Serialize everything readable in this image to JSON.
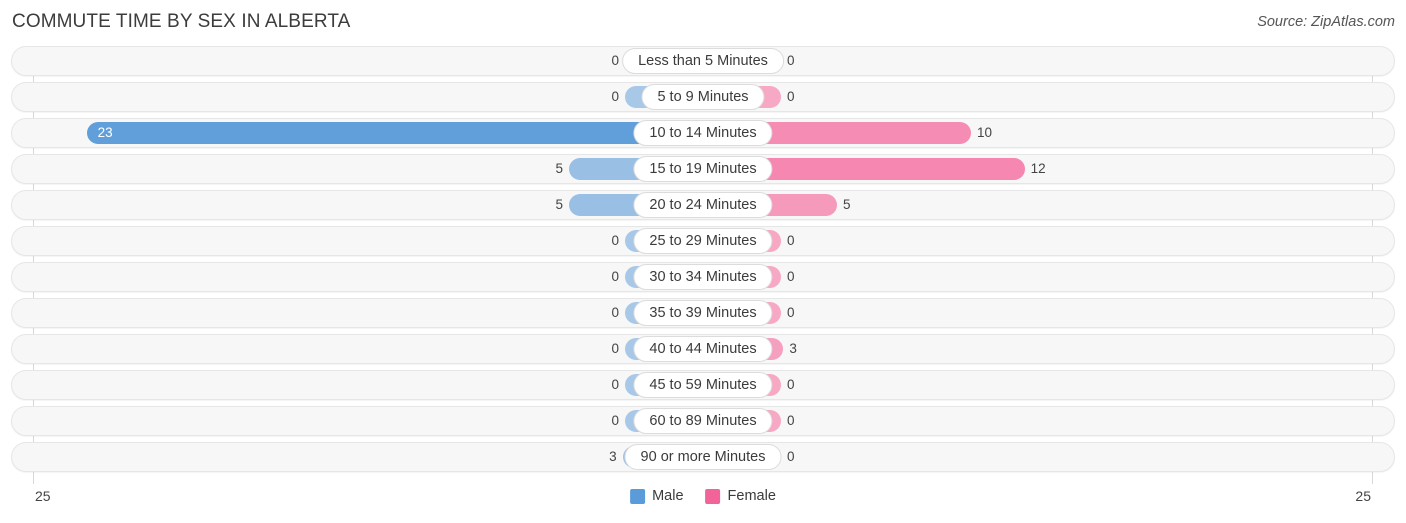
{
  "header": {
    "title": "COMMUTE TIME BY SEX IN ALBERTA",
    "source": "Source: ZipAtlas.com"
  },
  "axis": {
    "left_max_label": "25",
    "right_max_label": "25"
  },
  "legend": {
    "male_label": "Male",
    "female_label": "Female"
  },
  "colors": {
    "male_strong": "#5b9bd9",
    "male_light": "#a8c8e8",
    "female_strong": "#f2639a",
    "female_light": "#f7a8c4",
    "track": "#f7f7f7",
    "gridline": "#d8d8d8"
  },
  "chart_data": {
    "type": "bar",
    "subtype": "diverging-horizontal",
    "title": "COMMUTE TIME BY SEX IN ALBERTA",
    "source": "Source: ZipAtlas.com",
    "xlabel": "",
    "ylabel": "",
    "xlim": [
      25,
      25
    ],
    "axis_max": 25,
    "grid": true,
    "legend_position": "bottom-center",
    "categories": [
      "Less than 5 Minutes",
      "5 to 9 Minutes",
      "10 to 14 Minutes",
      "15 to 19 Minutes",
      "20 to 24 Minutes",
      "25 to 29 Minutes",
      "30 to 34 Minutes",
      "35 to 39 Minutes",
      "40 to 44 Minutes",
      "45 to 59 Minutes",
      "60 to 89 Minutes",
      "90 or more Minutes"
    ],
    "series": [
      {
        "name": "Male",
        "direction": "left",
        "values": [
          0,
          0,
          23,
          5,
          5,
          0,
          0,
          0,
          0,
          0,
          0,
          3
        ]
      },
      {
        "name": "Female",
        "direction": "right",
        "values": [
          0,
          0,
          10,
          12,
          5,
          0,
          0,
          0,
          3,
          0,
          0,
          0
        ]
      }
    ],
    "rows": [
      {
        "category": "Less than 5 Minutes",
        "male": 0,
        "female": 0,
        "male_label": "0",
        "female_label": "0"
      },
      {
        "category": "5 to 9 Minutes",
        "male": 0,
        "female": 0,
        "male_label": "0",
        "female_label": "0"
      },
      {
        "category": "10 to 14 Minutes",
        "male": 23,
        "female": 10,
        "male_label": "23",
        "female_label": "10"
      },
      {
        "category": "15 to 19 Minutes",
        "male": 5,
        "female": 12,
        "male_label": "5",
        "female_label": "12"
      },
      {
        "category": "20 to 24 Minutes",
        "male": 5,
        "female": 5,
        "male_label": "5",
        "female_label": "5"
      },
      {
        "category": "25 to 29 Minutes",
        "male": 0,
        "female": 0,
        "male_label": "0",
        "female_label": "0"
      },
      {
        "category": "30 to 34 Minutes",
        "male": 0,
        "female": 0,
        "male_label": "0",
        "female_label": "0"
      },
      {
        "category": "35 to 39 Minutes",
        "male": 0,
        "female": 0,
        "male_label": "0",
        "female_label": "0"
      },
      {
        "category": "40 to 44 Minutes",
        "male": 0,
        "female": 3,
        "male_label": "0",
        "female_label": "3"
      },
      {
        "category": "45 to 59 Minutes",
        "male": 0,
        "female": 0,
        "male_label": "0",
        "female_label": "0"
      },
      {
        "category": "60 to 89 Minutes",
        "male": 0,
        "female": 0,
        "male_label": "0",
        "female_label": "0"
      },
      {
        "category": "90 or more Minutes",
        "male": 3,
        "female": 0,
        "male_label": "3",
        "female_label": "0"
      }
    ]
  }
}
